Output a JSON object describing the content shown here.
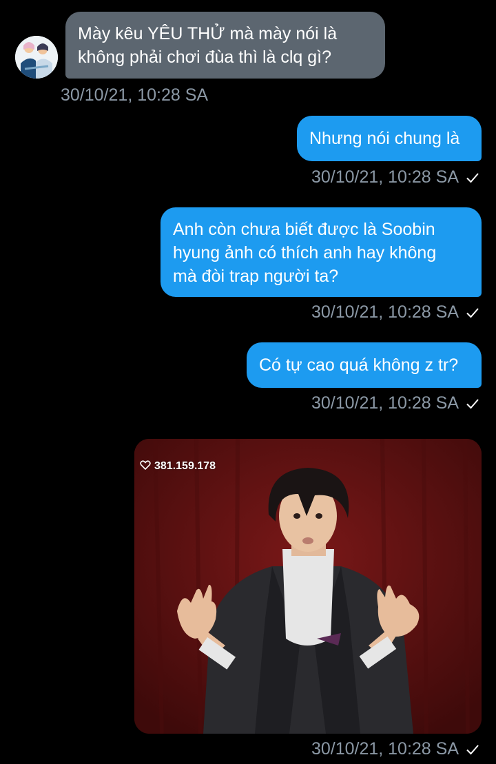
{
  "colors": {
    "background": "#000000",
    "incoming_bubble": "#5c6670",
    "outgoing_bubble": "#1d9bf0",
    "meta_text": "#8b98a5",
    "media_background": "#5c1010"
  },
  "messages": [
    {
      "direction": "incoming",
      "lines": [
        "Mày kêu YÊU THỬ mà mày nói là",
        "không phải chơi đùa thì là clq gì?"
      ],
      "time": "30/10/21, 10:28 SA",
      "avatar_icon": "user-avatar"
    },
    {
      "direction": "outgoing",
      "lines": [
        "Nhưng nói chung là"
      ],
      "time": "30/10/21, 10:28 SA",
      "status_icon": "check-icon"
    },
    {
      "direction": "outgoing",
      "lines": [
        "Anh còn chưa biết được là Soobin",
        "hyung ảnh có thích anh hay không",
        "mà đòi trap người ta?"
      ],
      "time": "30/10/21, 10:28 SA",
      "status_icon": "check-icon"
    },
    {
      "direction": "outgoing",
      "lines": [
        "Có tự cao quá không z tr?"
      ],
      "time": "30/10/21, 10:28 SA",
      "status_icon": "check-icon"
    },
    {
      "direction": "outgoing",
      "type": "image",
      "overlay_likes": "381.159.178",
      "overlay_icon": "heart-icon",
      "time": "30/10/21, 10:28 SA",
      "status_icon": "check-icon"
    }
  ]
}
